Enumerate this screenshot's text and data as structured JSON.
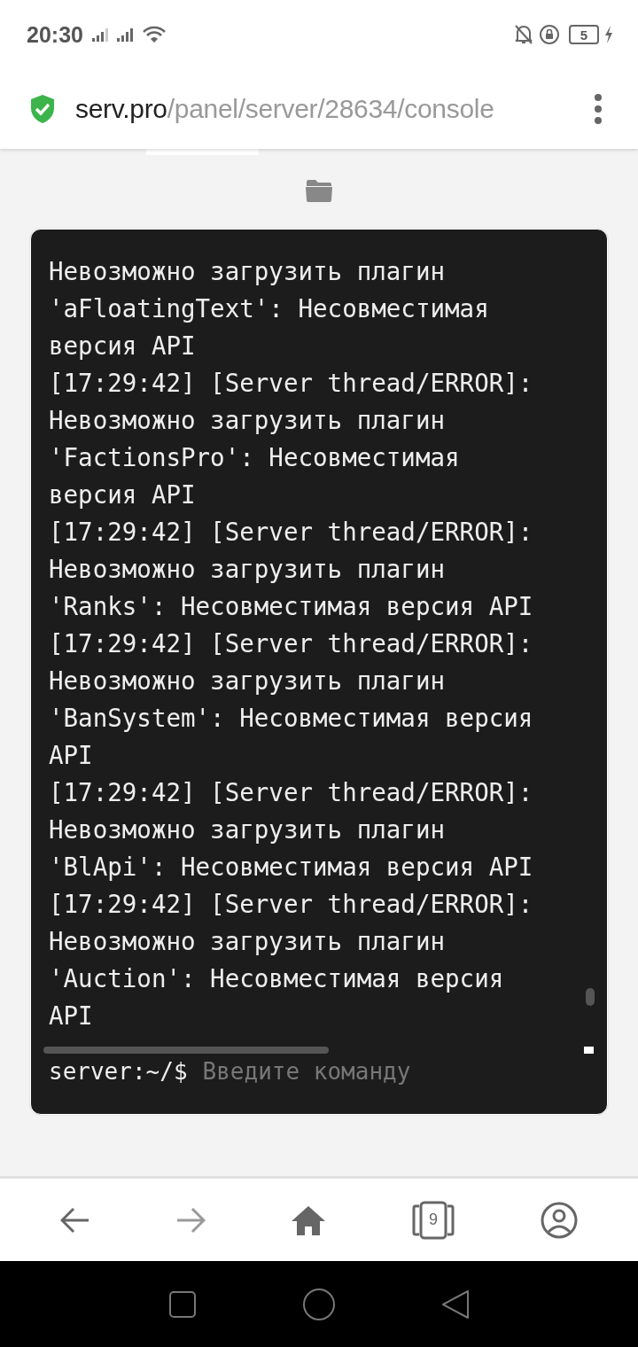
{
  "status_bar": {
    "time": "20:30",
    "battery": "5"
  },
  "address_bar": {
    "host": "serv.pro",
    "path": "/panel/server/28634/console"
  },
  "console": {
    "lines": [
      "Невозможно загрузить плагин",
      "'aFloatingText': Несовместимая",
      "версия API",
      "[17:29:42] [Server thread/ERROR]:",
      "Невозможно загрузить плагин",
      "'FactionsPro': Несовместимая",
      "версия API",
      "[17:29:42] [Server thread/ERROR]:",
      "Невозможно загрузить плагин",
      "'Ranks': Несовместимая версия API",
      "[17:29:42] [Server thread/ERROR]:",
      "Невозможно загрузить плагин",
      "'BanSystem': Несовместимая версия",
      "API",
      "[17:29:42] [Server thread/ERROR]:",
      "Невозможно загрузить плагин",
      "'BlApi': Несовместимая версия API",
      "[17:29:42] [Server thread/ERROR]:",
      "Невозможно загрузить плагин",
      "'Auction': Несовместимая версия",
      "API"
    ],
    "prompt": "server:~/$",
    "placeholder": "Введите команду"
  },
  "bottom_nav": {
    "tabs_count": "9"
  }
}
